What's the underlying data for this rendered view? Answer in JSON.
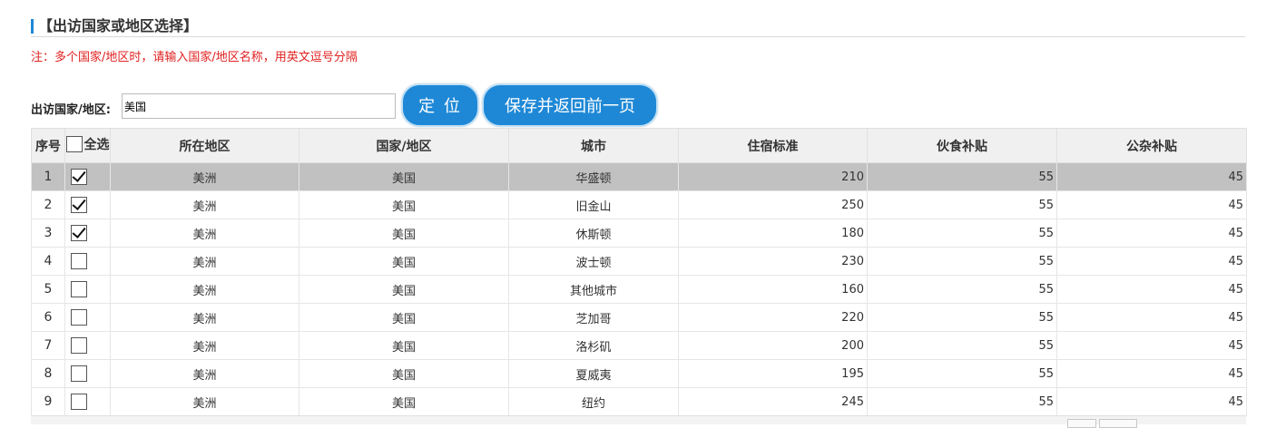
{
  "section": {
    "title": "【出访国家或地区选择】"
  },
  "note": "注：多个国家/地区时，请输入国家/地区名称，用英文逗号分隔",
  "locate": {
    "label": "出访国家/地区:",
    "input_value": "美国",
    "locate_button": "定 位",
    "save_button": "保存并返回前一页"
  },
  "table": {
    "headers": {
      "index": "序号",
      "select_all": "全选",
      "region": "所在地区",
      "country": "国家/地区",
      "city": "城市",
      "lodging": "住宿标准",
      "meal": "伙食补贴",
      "misc": "公杂补贴"
    },
    "rows": [
      {
        "index": "1",
        "checked": true,
        "selected": true,
        "region": "美洲",
        "country": "美国",
        "city": "华盛顿",
        "lodging": "210",
        "meal": "55",
        "misc": "45"
      },
      {
        "index": "2",
        "checked": true,
        "selected": false,
        "region": "美洲",
        "country": "美国",
        "city": "旧金山",
        "lodging": "250",
        "meal": "55",
        "misc": "45"
      },
      {
        "index": "3",
        "checked": true,
        "selected": false,
        "region": "美洲",
        "country": "美国",
        "city": "休斯顿",
        "lodging": "180",
        "meal": "55",
        "misc": "45"
      },
      {
        "index": "4",
        "checked": false,
        "selected": false,
        "region": "美洲",
        "country": "美国",
        "city": "波士顿",
        "lodging": "230",
        "meal": "55",
        "misc": "45"
      },
      {
        "index": "5",
        "checked": false,
        "selected": false,
        "region": "美洲",
        "country": "美国",
        "city": "其他城市",
        "lodging": "160",
        "meal": "55",
        "misc": "45"
      },
      {
        "index": "6",
        "checked": false,
        "selected": false,
        "region": "美洲",
        "country": "美国",
        "city": "芝加哥",
        "lodging": "220",
        "meal": "55",
        "misc": "45"
      },
      {
        "index": "7",
        "checked": false,
        "selected": false,
        "region": "美洲",
        "country": "美国",
        "city": "洛杉矶",
        "lodging": "200",
        "meal": "55",
        "misc": "45"
      },
      {
        "index": "8",
        "checked": false,
        "selected": false,
        "region": "美洲",
        "country": "美国",
        "city": "夏威夷",
        "lodging": "195",
        "meal": "55",
        "misc": "45"
      },
      {
        "index": "9",
        "checked": false,
        "selected": false,
        "region": "美洲",
        "country": "美国",
        "city": "纽约",
        "lodging": "245",
        "meal": "55",
        "misc": "45"
      }
    ]
  },
  "colors": {
    "accent": "#1e88d6",
    "note_red": "#e02020",
    "selected_row": "#c1c1c1",
    "header_bg": "#f0f0f0"
  },
  "icons": {
    "checked": "checkbox-checked-icon",
    "unchecked": "checkbox-unchecked-icon"
  }
}
